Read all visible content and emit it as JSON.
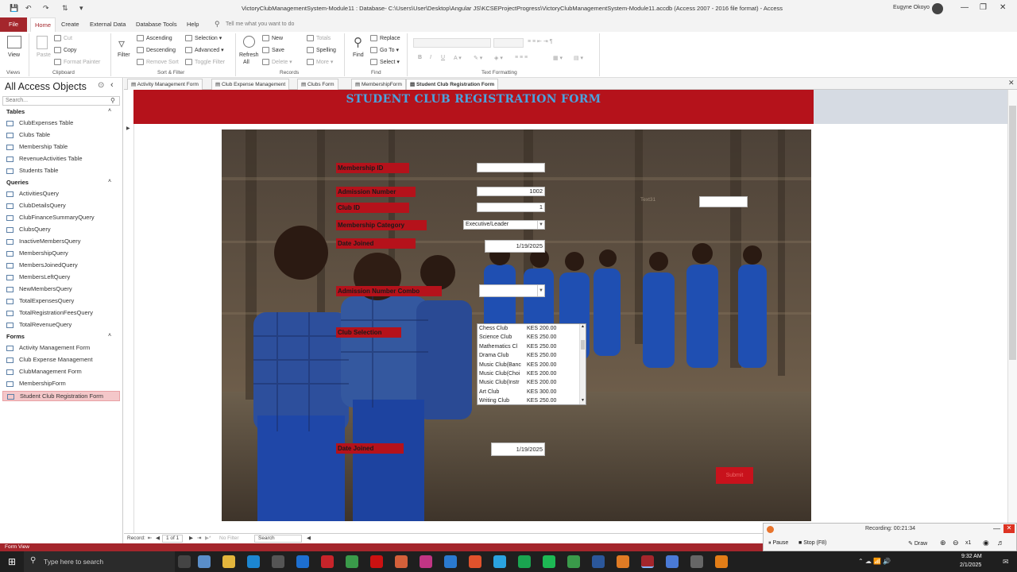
{
  "window": {
    "title": "VictoryClubManagementSystem-Module11 : Database- C:\\Users\\User\\Desktop\\Angular JS\\KCSEProjectProgress\\VictoryClubManagementSystem-Module11.accdb (Access 2007 - 2016 file format)  -  Access",
    "user": "Eugyne Okoyo"
  },
  "ribbon_tabs": [
    "File",
    "Home",
    "Create",
    "External Data",
    "Database Tools",
    "Help"
  ],
  "tell_me": "Tell me what you want to do",
  "ribbon": {
    "views": {
      "view": "View",
      "group": "Views"
    },
    "clipboard": {
      "paste": "Paste",
      "cut": "Cut",
      "copy": "Copy",
      "format_painter": "Format Painter",
      "group": "Clipboard"
    },
    "sort_filter": {
      "filter": "Filter",
      "ascending": "Ascending",
      "descending": "Descending",
      "remove_sort": "Remove Sort",
      "selection": "Selection",
      "advanced": "Advanced",
      "toggle_filter": "Toggle Filter",
      "group": "Sort & Filter"
    },
    "records": {
      "refresh": "Refresh",
      "refresh2": "All",
      "new": "New",
      "save": "Save",
      "delete": "Delete",
      "totals": "Totals",
      "spelling": "Spelling",
      "more": "More",
      "group": "Records"
    },
    "find": {
      "find": "Find",
      "replace": "Replace",
      "goto": "Go To",
      "select": "Select",
      "group": "Find"
    },
    "text_formatting": {
      "group": "Text Formatting"
    }
  },
  "nav": {
    "header": "All Access Objects",
    "search_placeholder": "Search...",
    "tables_label": "Tables",
    "tables": [
      "ClubExpenses Table",
      "Clubs Table",
      "Membership Table",
      "RevenueActivities Table",
      "Students Table"
    ],
    "queries_label": "Queries",
    "queries": [
      "ActivitiesQuery",
      "ClubDetailsQuery",
      "ClubFinanceSummaryQuery",
      "ClubsQuery",
      "InactiveMembersQuery",
      "MembershipQuery",
      "MembersJoinedQuery",
      "MembersLeftQuery",
      "NewMembersQuery",
      "TotalExpensesQuery",
      "TotalRegistrationFeesQuery",
      "TotalRevenueQuery"
    ],
    "forms_label": "Forms",
    "forms": [
      "Activity Management Form",
      "Club Expense Management",
      "ClubManagement Form",
      "MembershipForm",
      "Student Club Registration Form"
    ]
  },
  "doc_tabs": [
    "Activity Management Form",
    "Club Expense Management",
    "Clubs Form",
    "MembershipForm",
    "Student Club Registration Form"
  ],
  "form": {
    "title": "STUDENT CLUB REGISTRATION FORM",
    "membership_id_label": "Membership ID",
    "admission_number_label": "Admission Number",
    "admission_number": "1002",
    "club_id_label": "Club ID",
    "club_id": "1",
    "membership_category_label": "Membership Category",
    "membership_category": "Executive/Leader",
    "date_joined_label": "Date Joined",
    "date_joined": "1/19/2025",
    "admission_combo_label": "Admission Number Combo",
    "club_selection_label": "Club Selection",
    "text_label": "Text31",
    "date_joined2_label": "Date Joined",
    "date_joined2": "1/19/2025",
    "submit_label": "Submit",
    "clubs": [
      {
        "name": "Chess Club",
        "price": "KES 200.00"
      },
      {
        "name": "Science Club",
        "price": "KES 250.00"
      },
      {
        "name": "Mathematics Cl",
        "price": "KES 250.00"
      },
      {
        "name": "Drama Club",
        "price": "KES 250.00"
      },
      {
        "name": "Music Club(Banc",
        "price": "KES 200.00"
      },
      {
        "name": "Music Club(Choi",
        "price": "KES 200.00"
      },
      {
        "name": "Music Club(Instr",
        "price": "KES 200.00"
      },
      {
        "name": "Art Club",
        "price": "KES 300.00"
      },
      {
        "name": "Writing Club",
        "price": "KES 250.00"
      }
    ]
  },
  "record_nav": {
    "record": "Record:",
    "position": "1 of 1",
    "no_filter": "No Filter",
    "search": "Search"
  },
  "status": "Form View",
  "recording": {
    "text": "Recording: 00:21:34",
    "pause": "Pause",
    "stop": "Stop (F8)",
    "draw": "Draw",
    "zoom": "x1"
  },
  "taskbar": {
    "search": "Type here to search",
    "time": "9:32 AM",
    "date": "2/1/2025"
  },
  "colors": {
    "access_red": "#a4262c",
    "form_red": "#b5121b",
    "title_blue": "#4aa3df"
  }
}
